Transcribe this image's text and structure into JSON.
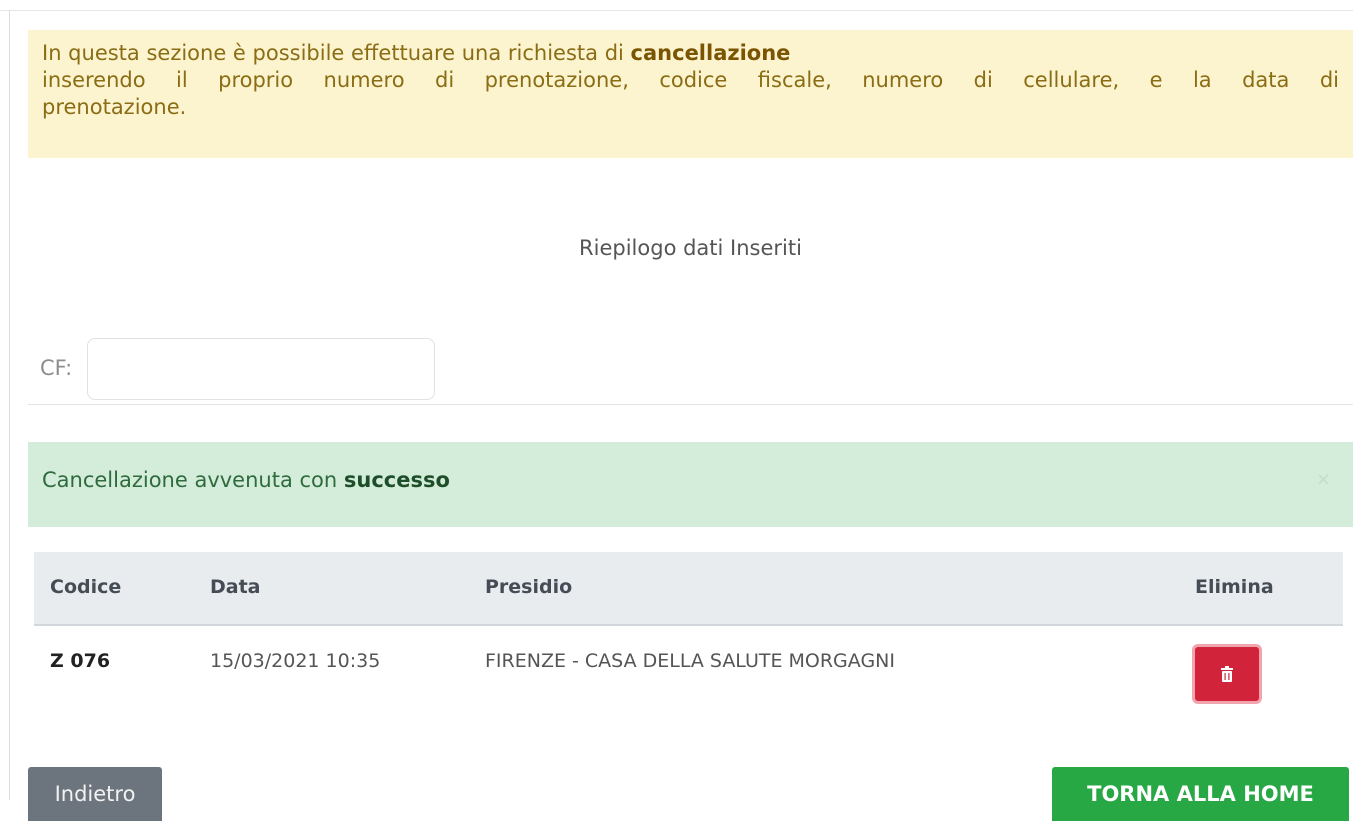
{
  "warning_box": {
    "line1_prefix": "In questa sezione è possibile effettuare una richiesta di ",
    "line1_bold": "cancellazione",
    "line2": "inserendo il proprio numero di prenotazione, codice fiscale, numero di cellulare, e la data di",
    "line3": "prenotazione."
  },
  "summary_title": "Riepilogo dati Inseriti",
  "cf_field": {
    "label": "CF:",
    "value": ""
  },
  "success_alert": {
    "text_prefix": "Cancellazione avvenuta con ",
    "text_bold": "successo",
    "close_symbol": "×"
  },
  "table": {
    "headers": [
      "Codice",
      "Data",
      "Presidio",
      "Elimina"
    ],
    "rows": [
      {
        "codice": "Z 076",
        "data": "15/03/2021 10:35",
        "presidio": "FIRENZE - CASA DELLA SALUTE MORGAGNI",
        "action_icon": "trash-icon"
      }
    ]
  },
  "buttons": {
    "back_label": "Indietro",
    "home_label": "TORNA ALLA HOME"
  },
  "colors": {
    "warning_bg": "#fcf3cf",
    "success_bg": "#d4edda",
    "danger": "#d1243a",
    "success_button": "#28a745",
    "secondary_button": "#6c757d"
  }
}
